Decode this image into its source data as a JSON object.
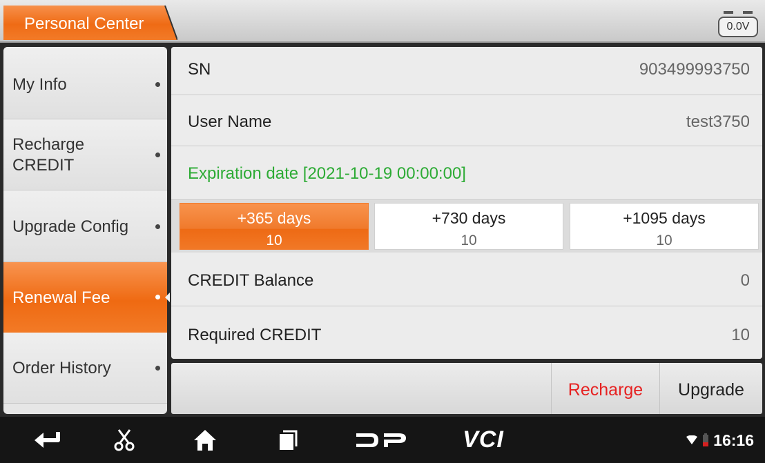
{
  "header": {
    "title": "Personal Center",
    "voltage": "0.0V",
    "accent": "#f07a2c"
  },
  "sidebar": {
    "items": [
      {
        "label": "My Info",
        "active": false
      },
      {
        "label": "Recharge CREDIT",
        "active": false
      },
      {
        "label": "Upgrade Config",
        "active": false
      },
      {
        "label": "Renewal Fee",
        "active": true
      },
      {
        "label": "Order History",
        "active": false
      }
    ]
  },
  "info": {
    "sn_label": "SN",
    "sn_value": "903499993750",
    "username_label": "User Name",
    "username_value": "test3750",
    "expiration": "Expiration date [2021-10-19 00:00:00]",
    "expiration_color": "#2dab35"
  },
  "plans": [
    {
      "days": "+365 days",
      "price": "10",
      "selected": true
    },
    {
      "days": "+730 days",
      "price": "10",
      "selected": false
    },
    {
      "days": "+1095 days",
      "price": "10",
      "selected": false
    }
  ],
  "balance": {
    "credit_balance_label": "CREDIT Balance",
    "credit_balance_value": "0",
    "required_credit_label": "Required CREDIT",
    "required_credit_value": "10"
  },
  "actions": {
    "recharge": "Recharge",
    "upgrade": "Upgrade",
    "recharge_color": "#e62222"
  },
  "navbar": {
    "icons": [
      "back-icon",
      "scissors-icon",
      "home-icon",
      "recent-apps-icon",
      "dp-logo-icon",
      "vci-logo-icon"
    ],
    "dp_text": "DP",
    "vci_text": "VCI",
    "time": "16:16"
  }
}
